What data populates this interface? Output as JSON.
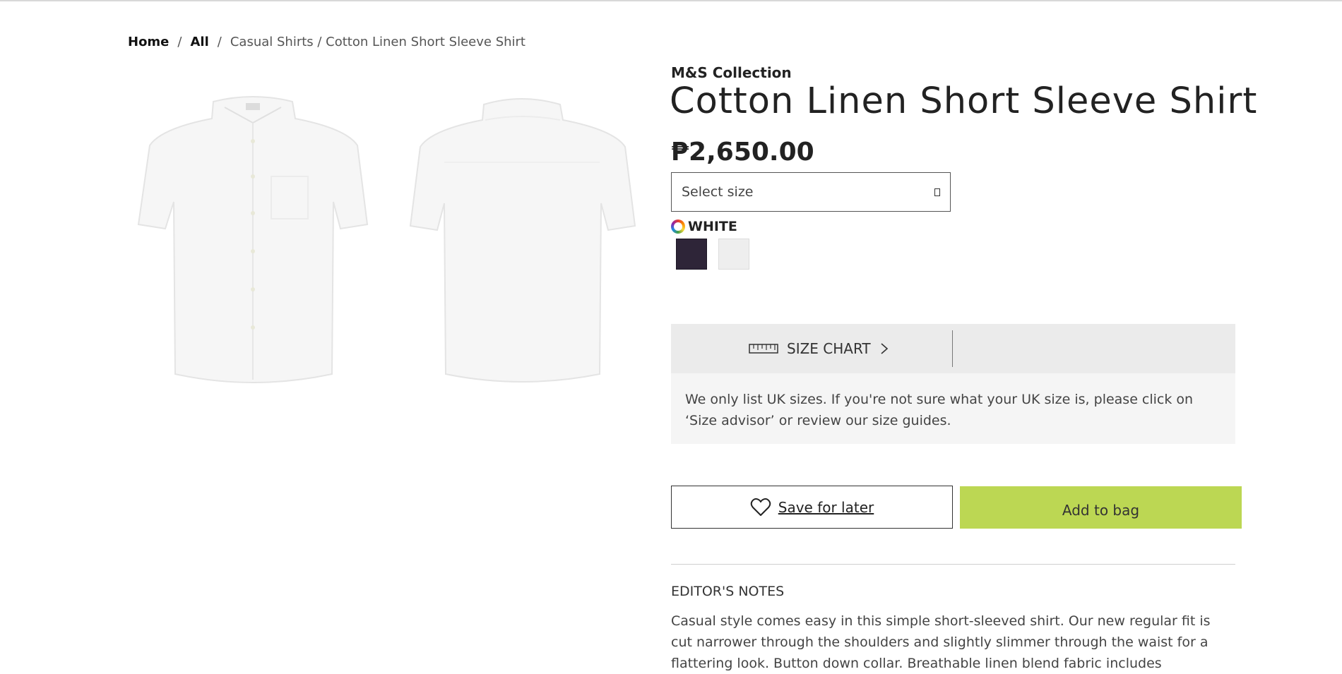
{
  "breadcrumb": {
    "home": "Home",
    "all": "All",
    "separator": "/",
    "current": "Casual Shirts / Cotton Linen Short Sleeve Shirt"
  },
  "product": {
    "brand": "M&S Collection",
    "title": "Cotton Linen Short Sleeve Shirt",
    "price": "₱2,650.00",
    "size_placeholder": "Select size",
    "colour_label": "WHITE",
    "swatches": [
      {
        "name": "navy",
        "color": "#2e2538"
      },
      {
        "name": "white",
        "color": "#eeeeee"
      }
    ]
  },
  "size_help": {
    "size_chart_label": "SIZE CHART",
    "note": "We only list UK sizes. If you're not sure what your UK size is, please click on ‘Size advisor’ or review our size guides."
  },
  "actions": {
    "save_for_later": "Save for later",
    "add_to_bag": "Add to bag",
    "add_to_bag_color": "#bcd753"
  },
  "editors_notes": {
    "heading": "EDITOR'S NOTES",
    "body": "Casual style comes easy in this simple short-sleeved shirt. Our new regular fit is cut narrower through the shoulders and slightly slimmer through the waist for a flattering look. Button down collar. Breathable linen blend fabric includes"
  }
}
